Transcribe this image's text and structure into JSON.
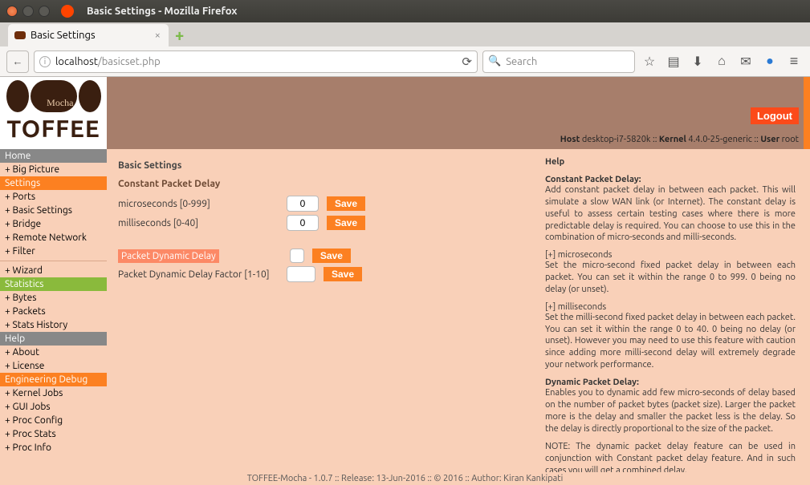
{
  "os": {
    "window_title": "Basic Settings - Mozilla Firefox"
  },
  "browser": {
    "tab_title": "Basic Settings",
    "url_host": "localhost",
    "url_path": "/basicset.php",
    "search_placeholder": "Search"
  },
  "header": {
    "logo_word": "TOFFEE",
    "logout_label": "Logout",
    "host_label": "Host",
    "host_value": "desktop-i7-5820k",
    "kernel_label": "Kernel",
    "kernel_value": "4.4.0-25-generic",
    "user_label": "User",
    "user_value": "root"
  },
  "sidebar": {
    "home": "Home",
    "big_picture": "+ Big Picture",
    "settings": "Settings",
    "ports": "+ Ports",
    "basic_settings": "+ Basic Settings",
    "bridge": "+ Bridge",
    "remote_network": "+ Remote Network",
    "filter": "+ Filter",
    "wizard": "+ Wizard",
    "statistics": "Statistics",
    "bytes": "+ Bytes",
    "packets": "+ Packets",
    "stats_history": "+ Stats History",
    "help": "Help",
    "about": "+ About",
    "license": "+ License",
    "eng_debug": "Engineering Debug",
    "kernel_jobs": "+ Kernel Jobs",
    "gui_jobs": "+ GUI Jobs",
    "proc_config": "+ Proc Config",
    "proc_stats": "+ Proc Stats",
    "proc_info": "+ Proc Info"
  },
  "main": {
    "page_title": "Basic Settings",
    "group1_title": "Constant Packet Delay",
    "micro_label": "microseconds [0-999]",
    "micro_value": "0",
    "milli_label": "milliseconds [0-40]",
    "milli_value": "0",
    "dyn_label": "Packet Dynamic Delay",
    "dyn_factor_label": "Packet Dynamic Delay Factor [1-10]",
    "dyn_factor_value": "",
    "save_label": "Save"
  },
  "help": {
    "title": "Help",
    "h1": "Constant Packet Delay:",
    "p1": "Add constant packet delay in between each packet. This will simulate a slow WAN link (or Internet). The constant delay is useful to assess certain testing cases where there is more predictable delay is required. You can choose to use this in the combination of micro-seconds and milli-seconds.",
    "h2": "[+] microseconds",
    "p2": "Set the micro-second fixed packet delay in between each packet. You can set it within the range 0 to 999. 0 being no delay (or unset).",
    "h3": "[+] milliseconds",
    "p3": "Set the milli-second fixed packet delay in between each packet. You can set it within the range 0 to 40. 0 being no delay (or unset). However you may need to use this feature with caution since adding more milli-second delay will extremely degrade your network performance.",
    "h4": "Dynamic Packet Delay:",
    "p4": "Enables you to dynamic add few micro-seconds of delay based on the number of packet bytes (packet size). Larger the packet more is the delay and smaller the packet less is the delay. So the delay is directly proportional to the size of the packet.",
    "p5": "NOTE: The dynamic packet delay feature can be used in conjunction with Constant packet delay feature. And in such cases you will get a combined delay."
  },
  "footer": {
    "line": "TOFFEE-Mocha - 1.0.7 :: Release: 13-Jun-2016 :: © 2016 :: Author: Kiran Kankipati"
  }
}
